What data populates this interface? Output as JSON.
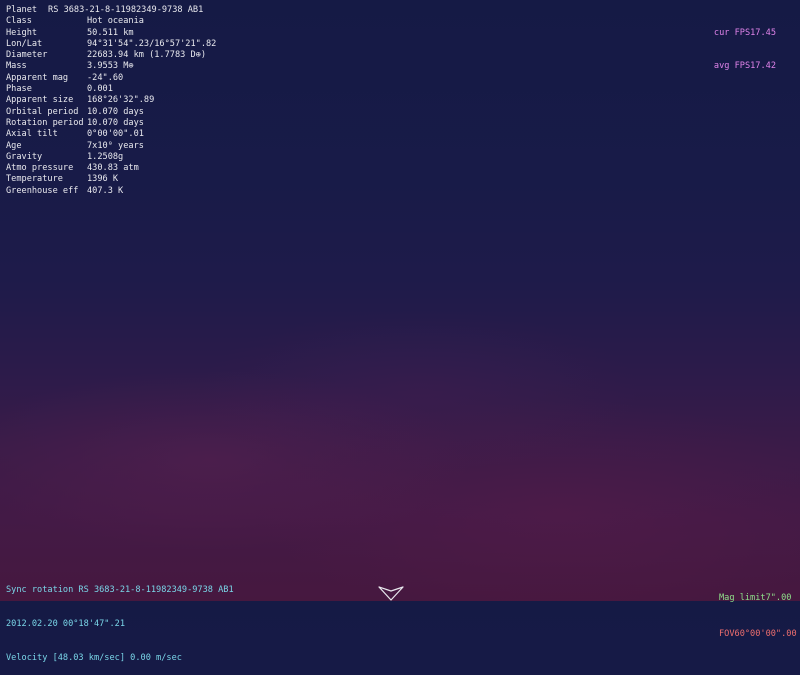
{
  "planet_info": {
    "title_label": "Planet",
    "title_value": "RS 3683-21-8-11982349-9738 AB1",
    "rows": [
      {
        "label": "Class",
        "value": "Hot oceania"
      },
      {
        "label": "Height",
        "value": "50.511 km"
      },
      {
        "label": "Lon/Lat",
        "value": "94°31'54\".23/16°57'21\".82"
      },
      {
        "label": "Diameter",
        "value": "22683.94 km (1.7783 D⊕)"
      },
      {
        "label": "Mass",
        "value": "3.9553 M⊕"
      },
      {
        "label": "Apparent mag",
        "value": "-24\".60"
      },
      {
        "label": "Phase",
        "value": "0.001"
      },
      {
        "label": "Apparent size",
        "value": "168°26'32\".89"
      },
      {
        "label": "Orbital period",
        "value": "10.070 days"
      },
      {
        "label": "Rotation period",
        "value": "10.070 days"
      },
      {
        "label": "Axial tilt",
        "value": "0°00'00\".01"
      },
      {
        "label": "Age",
        "value": "7x10⁹ years"
      },
      {
        "label": "Gravity",
        "value": "1.2508g"
      },
      {
        "label": "Atmo pressure",
        "value": "430.83 atm"
      },
      {
        "label": "Temperature",
        "value": "1396 K"
      },
      {
        "label": "Greenhouse eff",
        "value": "407.3 K"
      }
    ]
  },
  "fps": {
    "cur_label": "cur FPS",
    "cur_value": "17.45",
    "avg_label": "avg FPS",
    "avg_value": "17.42"
  },
  "status": {
    "mode": "Sync rotation RS 3683-21-8-11982349-9738 AB1",
    "datetime": "2012.02.20 00°18'47\".21",
    "velocity": "Velocity [48.03 km/sec] 0.00 m/sec"
  },
  "view": {
    "mag_limit_label": "Mag limit",
    "mag_limit_value": "7\".00",
    "fov_label": "FOV",
    "fov_value": "60°00'00\".00"
  },
  "colors": {
    "info_text": "#e9e9ee",
    "fps_text": "#e083ea",
    "status_text": "#7ad6e8",
    "mag_text": "#8ee08a",
    "fov_text": "#ee6e6e"
  },
  "icons": {
    "pointer": "triangle-pointer-icon"
  }
}
